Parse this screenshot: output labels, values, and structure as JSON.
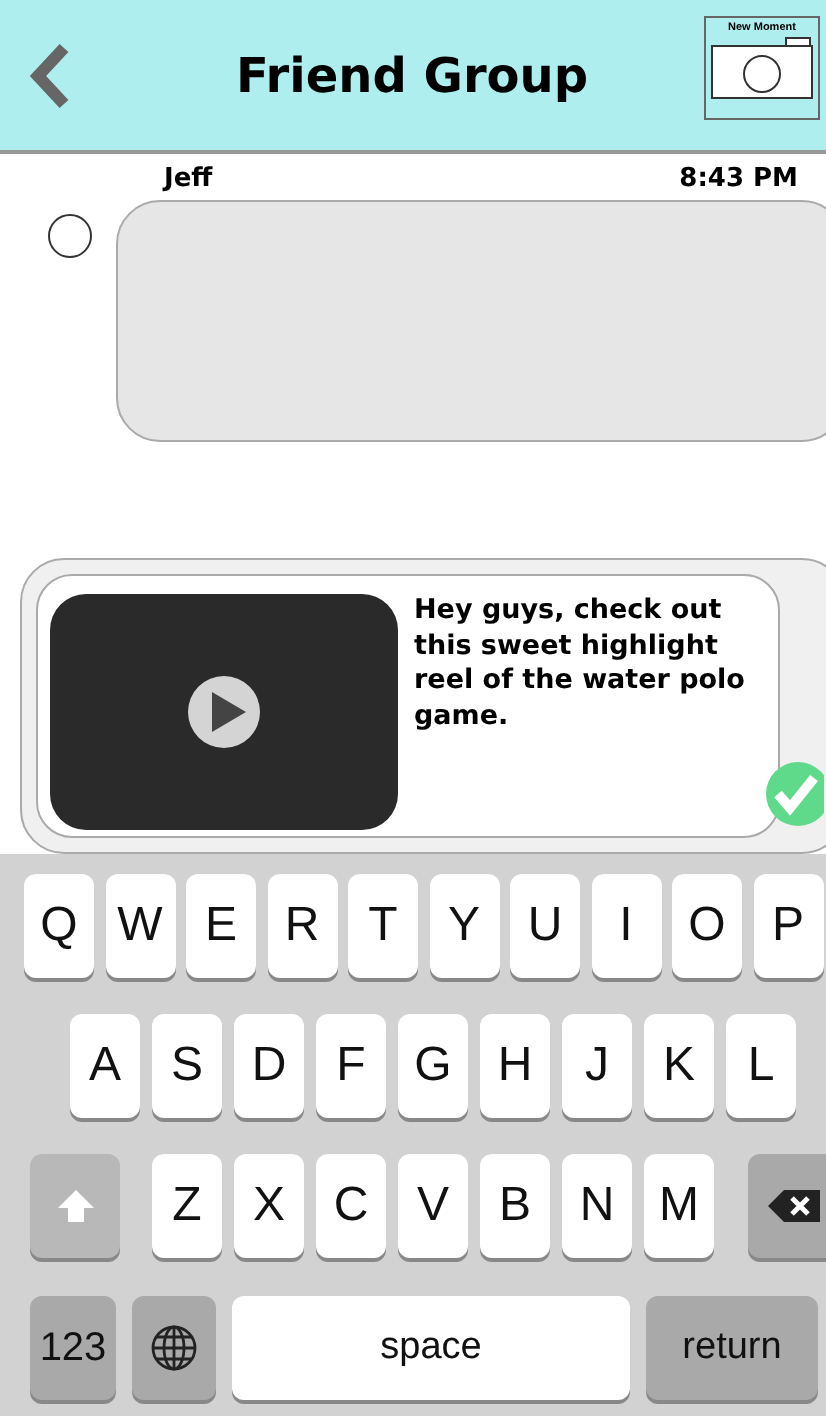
{
  "header": {
    "title": "Friend Group",
    "camera_button": {
      "label": "New Moment"
    }
  },
  "messages": [
    {
      "sender": "Jeff",
      "time": "8:43 PM",
      "selected": false
    }
  ],
  "composer": {
    "text": "Hey guys, check out this sweet highlight reel of the water polo game."
  },
  "keyboard": {
    "letter_rows": [
      [
        "Q",
        "W",
        "E",
        "R",
        "T",
        "Y",
        "U",
        "I",
        "O",
        "P"
      ],
      [
        "A",
        "S",
        "D",
        "F",
        "G",
        "H",
        "J",
        "K",
        "L"
      ],
      [
        "Z",
        "X",
        "C",
        "V",
        "B",
        "N",
        "M"
      ]
    ],
    "bottom_row": {
      "numbers_key": "123",
      "space_key": "space",
      "return_key": "return"
    }
  }
}
